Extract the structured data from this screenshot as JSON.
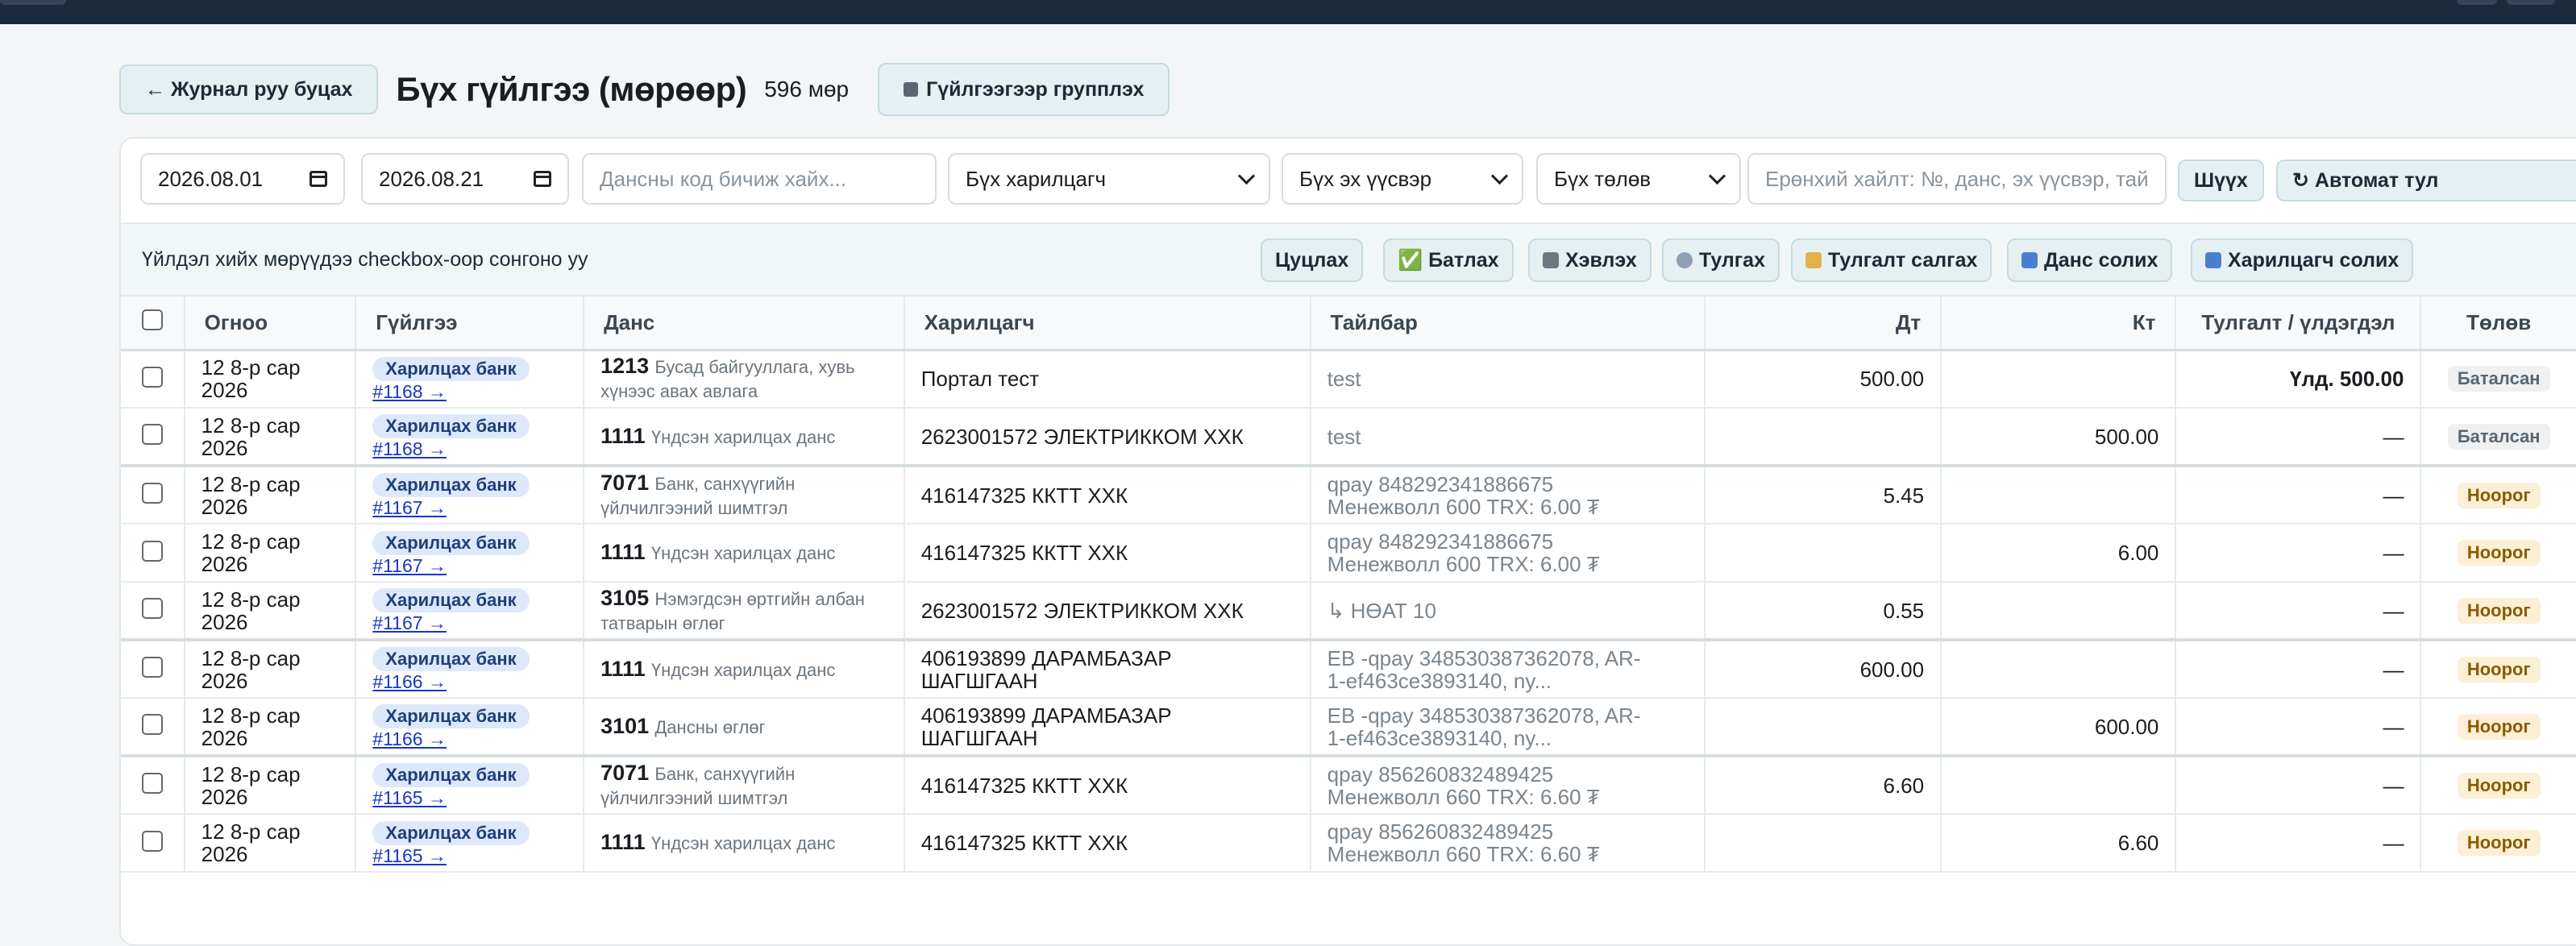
{
  "header": {
    "back_label": "← Журнал руу буцах",
    "title": "Бүх гүйлгээ (мөрөөр)",
    "count": "596 мөр",
    "group_label": "Гүйлгээгээр групплэх"
  },
  "filters": {
    "date_from": "2026.08.01",
    "date_to": "2026.08.21",
    "account_placeholder": "Дансны код бичиж хайх...",
    "partner_select": "Бүх харилцагч",
    "source_select": "Бүх эх үүсвэр",
    "status_select": "Бүх төлөв",
    "search_placeholder": "Ерөнхий хайлт: №, данс, эх үүсвэр, тай",
    "filter_button": "Шүүх",
    "auto_button": "↻ Автомат тул"
  },
  "actions": {
    "hint": "Үйлдэл хийх мөрүүдээ checkbox-оор сонгоно уу",
    "cancel": "Цуцлах",
    "approve": "✅ Батлах",
    "print": "Хэвлэх",
    "reconcile": "Тулгах",
    "unreconcile": "Тулгалт салгах",
    "change_account": "Данс солих",
    "change_partner": "Харилцагч солих"
  },
  "columns": [
    "Огноо",
    "Гүйлгээ",
    "Данс",
    "Харилцагч",
    "Тайлбар",
    "Дт",
    "Кт",
    "Тулгалт / үлдэгдэл",
    "Төлөв"
  ],
  "rows": [
    {
      "date1": "12 8-р сар",
      "date2": "2026",
      "src": "Харилцах банк",
      "ref": "#1168 →",
      "code": "1213",
      "acc": "Бусад байгууллага, хувь хүнээс авах авлага",
      "partner": "Портал тест",
      "d1": "test",
      "d2": "",
      "dt": "500.00",
      "kt": "",
      "rec": "Үлд. 500.00",
      "status": "Баталсан",
      "end": false
    },
    {
      "date1": "12 8-р сар",
      "date2": "2026",
      "src": "Харилцах банк",
      "ref": "#1168 →",
      "code": "1111",
      "acc": "Үндсэн харилцах данс",
      "partner": "2623001572 ЭЛЕКТРИККОМ ХХК",
      "d1": "test",
      "d2": "",
      "dt": "",
      "kt": "500.00",
      "rec": "—",
      "status": "Баталсан",
      "end": true
    },
    {
      "date1": "12 8-р сар",
      "date2": "2026",
      "src": "Харилцах банк",
      "ref": "#1167 →",
      "code": "7071",
      "acc": "Банк, санхүүгийн үйлчилгээний шимтгэл",
      "partner": "416147325 ККТТ ХХК",
      "d1": "qpay 848292341886675",
      "d2": "Менежволл 600 TRX: 6.00 ₮",
      "dt": "5.45",
      "kt": "",
      "rec": "—",
      "status": "Ноорог",
      "end": false
    },
    {
      "date1": "12 8-р сар",
      "date2": "2026",
      "src": "Харилцах банк",
      "ref": "#1167 →",
      "code": "1111",
      "acc": "Үндсэн харилцах данс",
      "partner": "416147325 ККТТ ХХК",
      "d1": "qpay 848292341886675",
      "d2": "Менежволл 600 TRX: 6.00 ₮",
      "dt": "",
      "kt": "6.00",
      "rec": "—",
      "status": "Ноорог",
      "end": false
    },
    {
      "date1": "12 8-р сар",
      "date2": "2026",
      "src": "Харилцах банк",
      "ref": "#1167 →",
      "code": "3105",
      "acc": "Нэмэгдсэн өртгийн албан татварын өглөг",
      "partner": "2623001572 ЭЛЕКТРИККОМ ХХК",
      "d1": "↳ НӨАТ 10",
      "d2": "",
      "dt": "0.55",
      "kt": "",
      "rec": "—",
      "status": "Ноорог",
      "end": true
    },
    {
      "date1": "12 8-р сар",
      "date2": "2026",
      "src": "Харилцах банк",
      "ref": "#1166 →",
      "code": "1111",
      "acc": "Үндсэн харилцах данс",
      "partner": "406193899 ДАРАМБАЗАР ШАГШГААН",
      "d1": "EB -qpay 348530387362078, AR-",
      "d2": "1-ef463ce3893140, ny...",
      "dt": "600.00",
      "kt": "",
      "rec": "—",
      "status": "Ноорог",
      "end": false
    },
    {
      "date1": "12 8-р сар",
      "date2": "2026",
      "src": "Харилцах банк",
      "ref": "#1166 →",
      "code": "3101",
      "acc": "Дансны өглөг",
      "partner": "406193899 ДАРАМБАЗАР ШАГШГААН",
      "d1": "EB -qpay 348530387362078, AR-",
      "d2": "1-ef463ce3893140, ny...",
      "dt": "",
      "kt": "600.00",
      "rec": "—",
      "status": "Ноорог",
      "end": true
    },
    {
      "date1": "12 8-р сар",
      "date2": "2026",
      "src": "Харилцах банк",
      "ref": "#1165 →",
      "code": "7071",
      "acc": "Банк, санхүүгийн үйлчилгээний шимтгэл",
      "partner": "416147325 ККТТ ХХК",
      "d1": "qpay 856260832489425",
      "d2": "Менежволл 660 TRX: 6.60 ₮",
      "dt": "6.60",
      "kt": "",
      "rec": "—",
      "status": "Ноорог",
      "end": false
    },
    {
      "date1": "12 8-р сар",
      "date2": "2026",
      "src": "Харилцах банк",
      "ref": "#1165 →",
      "code": "1111",
      "acc": "Үндсэн харилцах данс",
      "partner": "416147325 ККТТ ХХК",
      "d1": "qpay 856260832489425",
      "d2": "Менежволл 660 TRX: 6.60 ₮",
      "dt": "",
      "kt": "6.60",
      "rec": "—",
      "status": "Ноорог",
      "end": false
    }
  ]
}
